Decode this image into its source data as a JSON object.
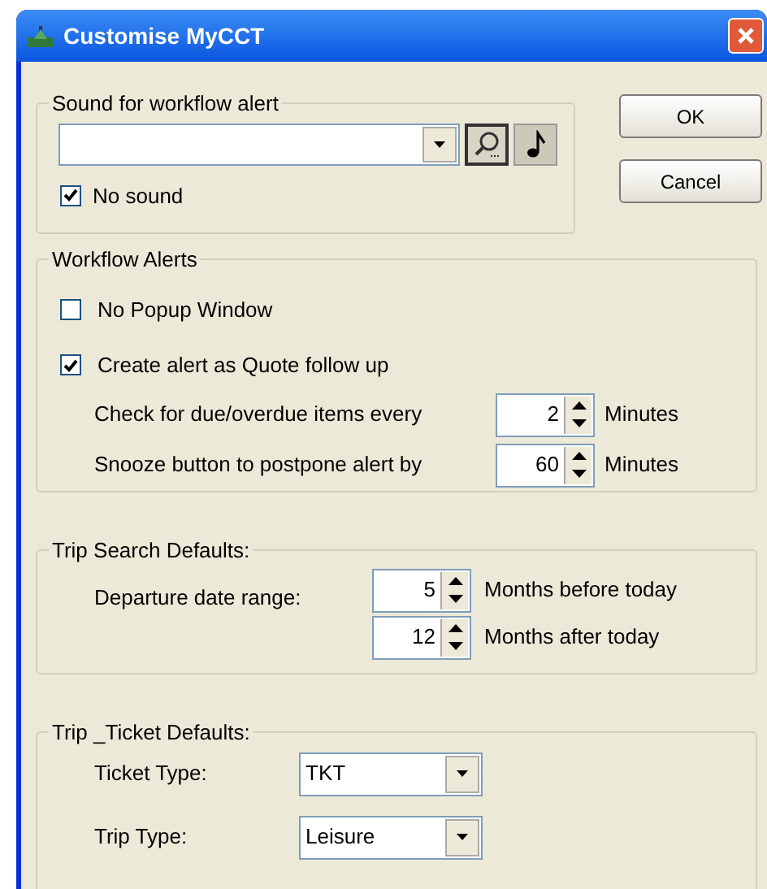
{
  "window": {
    "title": "Customise MyCCT"
  },
  "sound_group": {
    "title": "Sound for workflow alert",
    "no_sound": {
      "label": "No sound",
      "checked": true
    }
  },
  "buttons": [
    {
      "label": "OK"
    },
    {
      "label": "Cancel"
    }
  ],
  "workflow_alerts": {
    "title": "Workflow Alerts",
    "checkboxes": [
      {
        "label": "No Popup Window",
        "checked": false
      },
      {
        "label": "Create alert as Quote follow up",
        "checked": true
      }
    ],
    "spinners": [
      {
        "label": "Check for due/overdue items every",
        "value": "2",
        "unit": "Minutes"
      },
      {
        "label": "Snooze button to postpone alert by",
        "value": "60",
        "unit": "Minutes"
      }
    ]
  },
  "trip_search_defaults": {
    "title": "Trip Search Defaults:",
    "label": "Departure date range:",
    "spinners": [
      {
        "value": "5",
        "unit": "Months before today"
      },
      {
        "value": "12",
        "unit": "Months after today"
      }
    ]
  },
  "trip_ticket_defaults": {
    "title": "Trip _Ticket Defaults:",
    "dropdowns": [
      {
        "label": "Ticket Type:",
        "value": "TKT"
      },
      {
        "label": "Trip Type:",
        "value": "Leisure"
      }
    ]
  }
}
